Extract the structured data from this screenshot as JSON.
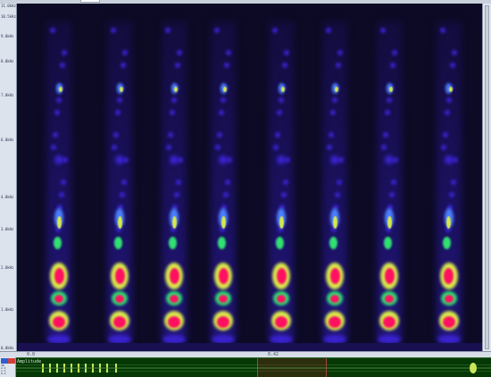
{
  "ruler": {
    "ticks": [
      "11.0kHz",
      "10.5kHz",
      "9.0kHz",
      "8.0kHz",
      "7.0kHz",
      "6.0kHz",
      "4.0kHz",
      "3.0kHz",
      "2.0kHz",
      "1.0kHz",
      "0.0kHz"
    ]
  },
  "timebar": {
    "left_label": "0.0",
    "cursor_label": "0.42"
  },
  "amplitude": {
    "label": "Amplitude"
  },
  "sidebar": {
    "lines": [
      "dB",
      "2.0",
      "1.5",
      "0.9"
    ]
  },
  "colors": {
    "background": "#0c0a24",
    "formant_low": "#3a22d0",
    "formant_mid": "#4a80ff",
    "formant_yellow": "#d8e84a",
    "formant_green": "#30e070",
    "formant_hot": "#ff1060",
    "amplitude_bg": "#063806",
    "amplitude_wave": "#c8e85a"
  }
}
